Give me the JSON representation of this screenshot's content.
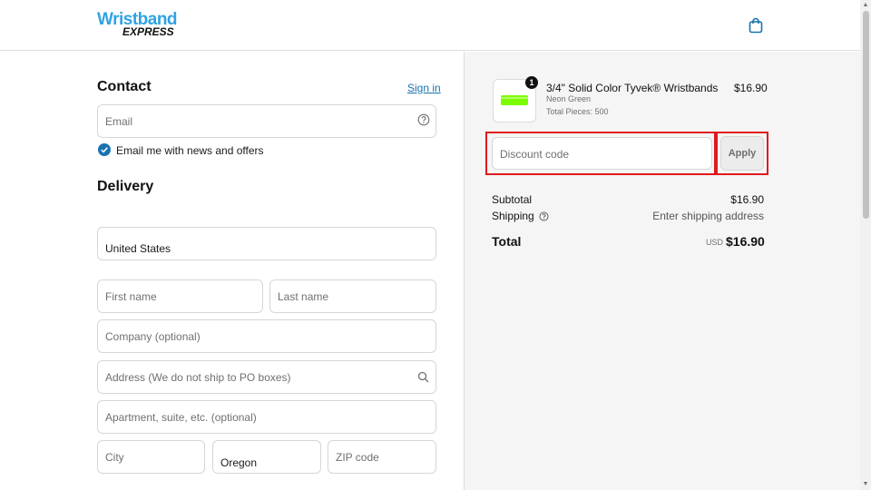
{
  "brand": {
    "name_top": "Wristband",
    "name_bottom": "EXPRESS"
  },
  "contact": {
    "heading": "Contact",
    "sign_in": "Sign in",
    "email_placeholder": "Email",
    "newsletter_label": "Email me with news and offers",
    "newsletter_checked": true
  },
  "delivery": {
    "heading": "Delivery",
    "country": "United States",
    "first_name_placeholder": "First name",
    "last_name_placeholder": "Last name",
    "company_placeholder": "Company (optional)",
    "address_placeholder": "Address (We do not ship to PO boxes)",
    "apartment_placeholder": "Apartment, suite, etc. (optional)",
    "city_placeholder": "City",
    "state": "Oregon",
    "zip_placeholder": "ZIP code"
  },
  "cart": {
    "quantity_badge": "1",
    "product_name": "3/4\" Solid Color Tyvek® Wristbands",
    "variant": "Neon Green",
    "pieces": "Total Pieces: 500",
    "price": "$16.90"
  },
  "discount": {
    "placeholder": "Discount code",
    "apply_label": "Apply"
  },
  "summary": {
    "subtotal_label": "Subtotal",
    "subtotal_value": "$16.90",
    "shipping_label": "Shipping",
    "shipping_value": "Enter shipping address",
    "total_label": "Total",
    "currency": "USD",
    "total_value": "$16.90"
  },
  "colors": {
    "accent": "#1773b0",
    "brand_blue": "#2ea3e3",
    "highlight": "#e0191e",
    "product_green": "#7CFC00"
  }
}
